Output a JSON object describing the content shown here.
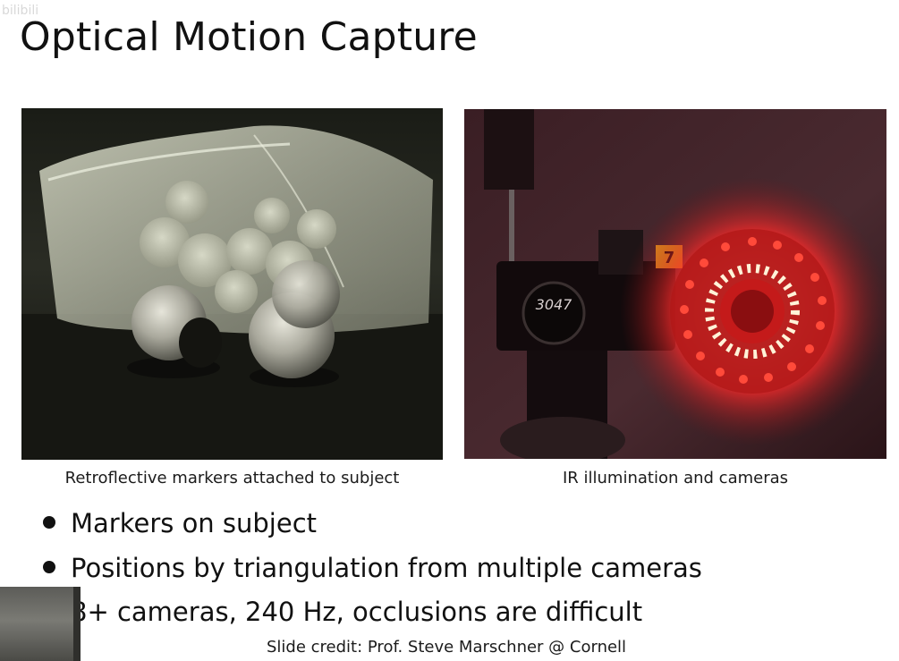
{
  "slide": {
    "title": "Optical Motion Capture",
    "watermark": "bilibili"
  },
  "figures": [
    {
      "caption": "Retroflective markers attached to subject"
    },
    {
      "caption": "IR illumination and cameras",
      "camera_label": "3047",
      "tag": "7"
    }
  ],
  "bullets": [
    "Markers on subject",
    "Positions by triangulation from multiple cameras"
  ],
  "extra_line": "8+ cameras, 240 Hz, occlusions are difficult",
  "credit": "Slide credit: Prof. Steve Marschner @ Cornell",
  "colors": {
    "led_red": "#ff2a2a",
    "marker_silver": "#c9c8bd"
  }
}
